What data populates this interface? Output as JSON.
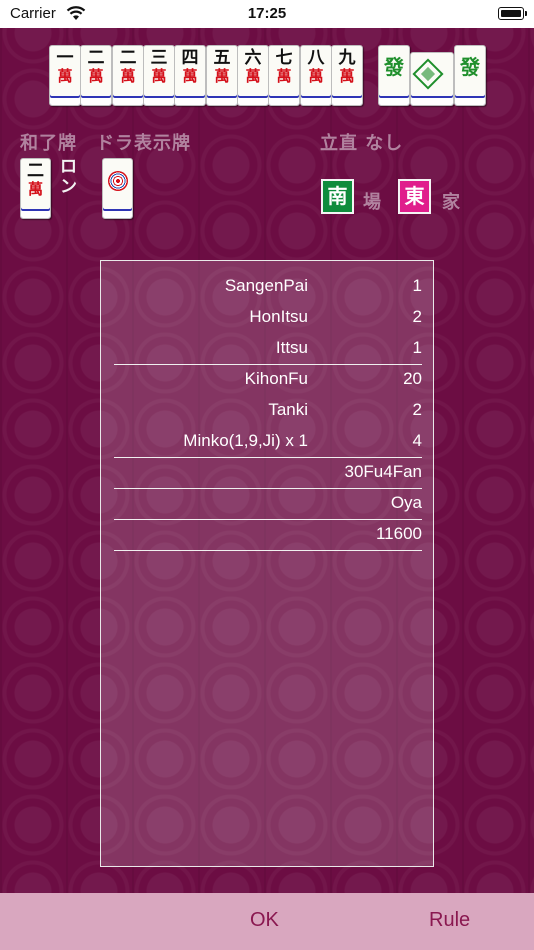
{
  "status_bar": {
    "carrier": "Carrier",
    "time": "17:25"
  },
  "hand": {
    "tiles": [
      {
        "num": "一",
        "suit": "萬"
      },
      {
        "num": "二",
        "suit": "萬"
      },
      {
        "num": "二",
        "suit": "萬"
      },
      {
        "num": "三",
        "suit": "萬"
      },
      {
        "num": "四",
        "suit": "萬"
      },
      {
        "num": "五",
        "suit": "萬"
      },
      {
        "num": "六",
        "suit": "萬"
      },
      {
        "num": "七",
        "suit": "萬"
      },
      {
        "num": "八",
        "suit": "萬"
      },
      {
        "num": "九",
        "suit": "萬"
      }
    ],
    "meld": {
      "left": "發",
      "right": "發"
    }
  },
  "labels": {
    "winning_tile": "和了牌",
    "dora_indicator": "ドラ表示牌",
    "riichi_status": "立直 なし",
    "ron": "ロン",
    "round_suffix": "場",
    "seat_suffix": "家"
  },
  "winning_tile": {
    "num": "二",
    "suit": "萬"
  },
  "round_wind": "南",
  "seat_wind": "東",
  "colors": {
    "background": "#6c0d43",
    "round_wind_bg": "#0f8c3c",
    "seat_wind_bg": "#e01e8c",
    "tile_back_blue": "#2f35b5",
    "bottom_bar": "#d9a7bf",
    "button_text": "#8a1850"
  },
  "score": {
    "rows": [
      {
        "name": "SangenPai",
        "value": "1"
      },
      {
        "name": "HonItsu",
        "value": "2"
      },
      {
        "name": "Ittsu",
        "value": "1"
      },
      {
        "name": "KihonFu",
        "value": "20"
      },
      {
        "name": "Tanki",
        "value": "2"
      },
      {
        "name": "Minko(1,9,Ji) x 1",
        "value": "4"
      }
    ],
    "summary": "30Fu4Fan",
    "dealer": "Oya",
    "total": "11600"
  },
  "buttons": {
    "ok": "OK",
    "rule": "Rule"
  }
}
